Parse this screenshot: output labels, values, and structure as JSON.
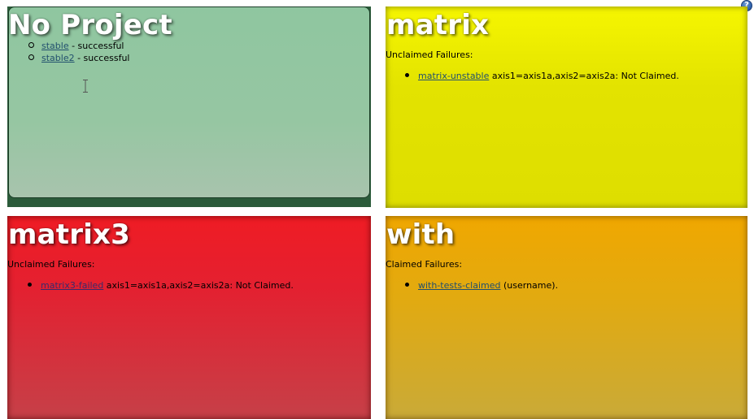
{
  "help": {
    "glyph": "?"
  },
  "panels": [
    {
      "title": "No Project",
      "items": [
        {
          "link": "stable",
          "text": " - successful"
        },
        {
          "link": "stable2",
          "text": " - successful"
        }
      ]
    },
    {
      "title": "matrix",
      "section": "Unclaimed Failures:",
      "items": [
        {
          "link": "matrix-unstable",
          "text": " axis1=axis1a,axis2=axis2a: Not Claimed."
        }
      ]
    },
    {
      "title": "matrix3",
      "section": "Unclaimed Failures:",
      "items": [
        {
          "link": "matrix3-failed",
          "text": " axis1=axis1a,axis2=axis2a: Not Claimed."
        }
      ]
    },
    {
      "title": "with",
      "section": "Claimed Failures:",
      "items": [
        {
          "link": "with-tests-claimed",
          "text": " (username)."
        }
      ]
    }
  ],
  "colors": {
    "no_project": "#8fc6a0",
    "matrix": "#e3e300",
    "matrix3": "#e42030",
    "with": "#e2aa10"
  }
}
